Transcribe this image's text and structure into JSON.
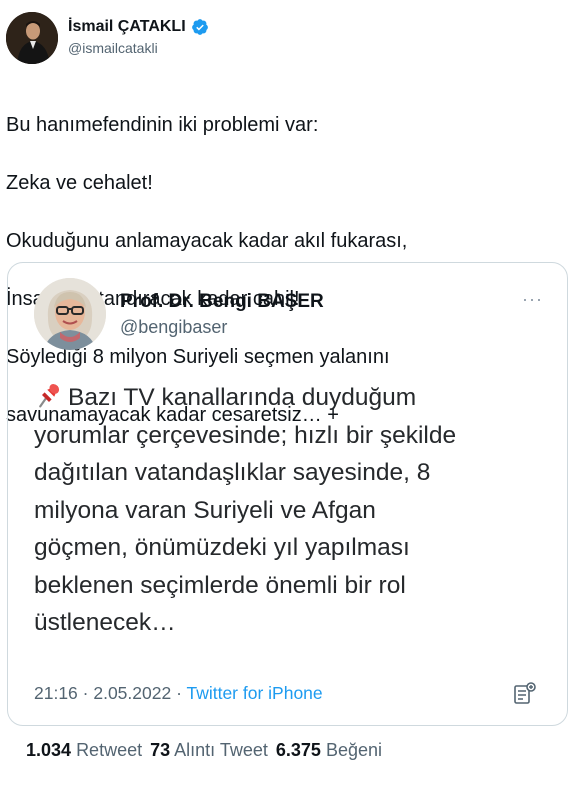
{
  "author": {
    "display_name": "İsmail ÇATAKLI",
    "handle": "@ismailcatakli"
  },
  "tweet": {
    "lines": [
      "Bu hanımefendinin iki problemi var:",
      "Zeka ve cehalet!",
      "Okuduğunu anlamayacak kadar akıl fukarası,",
      "İnsanlığı utandıracak kadar cahil!",
      "Söylediği 8 milyon Suriyeli seçmen yalanını",
      "savunamayacak kadar cesaretsiz… +"
    ]
  },
  "quote": {
    "display_name": "Prof. Dr. Bengi BAŞER",
    "handle": "@bengibaser",
    "more_label": "···",
    "text": "Bazı TV kanallarında duyduğum yorumlar çerçevesinde; hızlı bir şekilde dağıtılan vatandaşlıklar sayesinde, 8 milyona varan Suriyeli ve Afgan göçmen, önümüzdeki yıl yapılması beklenen seçimlerde önemli bir rol üstlenecek…",
    "lines": [
      "Bazı TV kanallarında duyduğum",
      "yorumlar çerçevesinde; hızlı bir şekilde",
      "dağıtılan vatandaşlıklar sayesinde, 8",
      "milyona varan Suriyeli ve Afgan",
      "göçmen, önümüzdeki yıl yapılması",
      "beklenen seçimlerde önemli bir rol",
      "üstlenecek…"
    ],
    "time": "21:16",
    "sep": " · ",
    "date": "2.05.2022",
    "source": "Twitter for iPhone"
  },
  "stats": {
    "retweets": "1.034",
    "retweets_label": "Retweet",
    "quotes": "73",
    "quotes_label": "Alıntı Tweet",
    "likes": "6.375",
    "likes_label": "Beğeni"
  },
  "icons": {
    "verified": "verified-badge-icon",
    "pin": "pushpin-icon",
    "notes": "notes-icon"
  },
  "colors": {
    "verified": "#1d9bf0",
    "link": "#1d9bf0",
    "secondary": "#536471",
    "border": "#cfd9de"
  }
}
